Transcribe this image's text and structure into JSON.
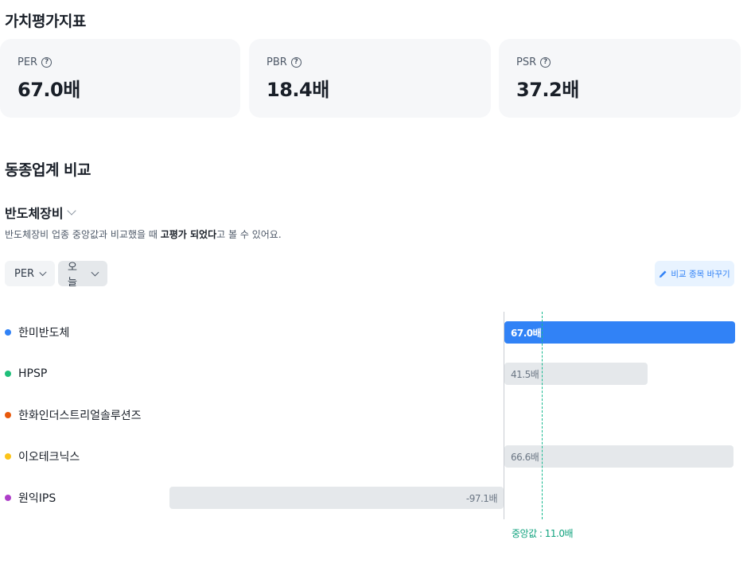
{
  "valuation": {
    "title": "가치평가지표",
    "cards": [
      {
        "label": "PER",
        "value": "67.0배"
      },
      {
        "label": "PBR",
        "value": "18.4배"
      },
      {
        "label": "PSR",
        "value": "37.2배"
      }
    ],
    "help_icon": "?"
  },
  "comparison": {
    "title": "동종업계 비교",
    "industry": "반도체장비",
    "desc_prefix": "반도체장비 업종 중앙값과 비교했을 때 ",
    "desc_bold": "고평가 되었다",
    "desc_suffix": "고 볼 수 있어요.",
    "metric_dropdown": "PER",
    "period_dropdown": "오늘",
    "change_button": "비교 종목 바꾸기",
    "median_label": "중앙값 : 11.0배"
  },
  "chart_data": {
    "type": "bar",
    "orientation": "horizontal",
    "median": 11.0,
    "series": [
      {
        "name": "한미반도체",
        "value": 67.0,
        "label": "67.0배",
        "color": "#3182f6",
        "highlight": true
      },
      {
        "name": "HPSP",
        "value": 41.5,
        "label": "41.5배",
        "color": "#1fbf7a"
      },
      {
        "name": "한화인더스트리얼솔루션즈",
        "value": null,
        "label": "",
        "color": "#e8590c"
      },
      {
        "name": "이오테크닉스",
        "value": 66.6,
        "label": "66.6배",
        "color": "#fcc419"
      },
      {
        "name": "원익IPS",
        "value": -97.1,
        "label": "-97.1배",
        "color": "#ae3ec9"
      }
    ]
  }
}
